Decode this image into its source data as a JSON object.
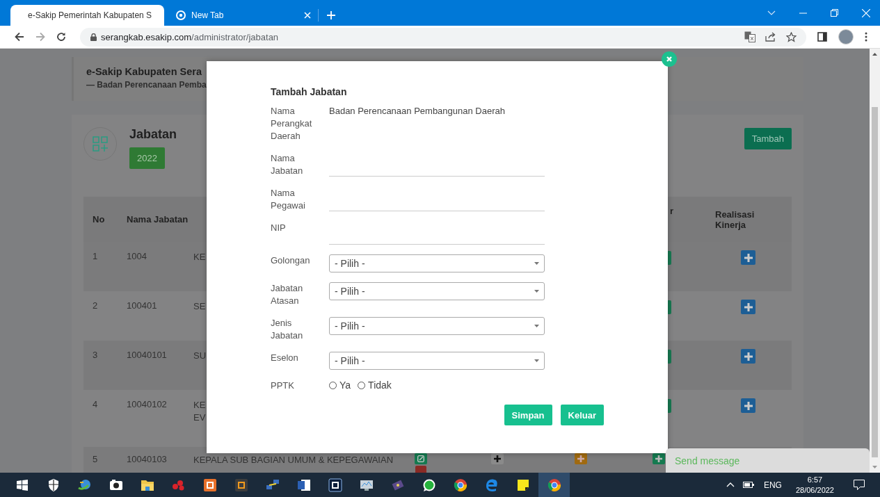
{
  "browser": {
    "tabs": [
      {
        "kind": "site",
        "title": "e-Sakip Pemerintah Kabupaten S",
        "selected": true
      },
      {
        "kind": "newtab",
        "title": "New Tab",
        "selected": false
      }
    ],
    "url_host": "serangkab.esakip.com",
    "url_path": "/administrator/jabatan"
  },
  "page": {
    "site_title": "e-Sakip Kabupaten Sera",
    "site_subtitle": "— Badan Perencanaan Pemba",
    "section_title": "Jabatan",
    "year_badge": "2022",
    "add_button": "Tambah",
    "table": {
      "column_headers": [
        "No",
        "Nama Jabatan",
        "r",
        "Realisasi Kinerja"
      ],
      "rows": [
        {
          "kind": "covered",
          "no": "1",
          "code": "1004",
          "name": "KE"
        },
        {
          "kind": "covered",
          "no": "2",
          "code": "100401",
          "name": "SE"
        },
        {
          "kind": "covered",
          "no": "3",
          "code": "10040101",
          "name": "SU"
        },
        {
          "kind": "covered",
          "no": "4",
          "code": "10040102",
          "name": "KE\nEV"
        },
        {
          "kind": "open",
          "no": "5",
          "code": "10040103",
          "name": "KEPALA SUB BAGIAN UMUM & KEPEGAWAIAN"
        }
      ]
    }
  },
  "modal": {
    "title": "Tambah Jabatan",
    "fields": [
      {
        "kind": "text",
        "label": "Nama Perangkat Daerah",
        "value": "Badan Perencanaan Pembangunan Daerah"
      },
      {
        "kind": "input",
        "label": "Nama Jabatan"
      },
      {
        "kind": "input",
        "label": "Nama Pegawai"
      },
      {
        "kind": "input",
        "label": "NIP"
      },
      {
        "kind": "select",
        "label": "Golongan",
        "value": "- Pilih -"
      },
      {
        "kind": "select",
        "label": "Jabatan Atasan",
        "value": "- Pilih -"
      },
      {
        "kind": "select",
        "label": "Jenis Jabatan",
        "value": "- Pilih -"
      },
      {
        "kind": "select",
        "label": "Eselon",
        "value": "- Pilih -"
      },
      {
        "kind": "radio",
        "label": "PPTK",
        "options": [
          {
            "label": "Ya",
            "selected": false
          },
          {
            "label": "Tidak",
            "selected": false
          }
        ]
      }
    ],
    "buttons": [
      "Simpan",
      "Keluar"
    ]
  },
  "chat": {
    "label": "Send message"
  },
  "taskbar": {
    "items": [
      {
        "kind": "start",
        "selected": false
      },
      {
        "kind": "shield",
        "selected": false
      },
      {
        "kind": "globe",
        "selected": false
      },
      {
        "kind": "camera",
        "selected": false
      },
      {
        "kind": "folder",
        "selected": false
      },
      {
        "kind": "dots",
        "selected": false
      },
      {
        "kind": "tile-orange",
        "selected": false
      },
      {
        "kind": "tile-dark",
        "selected": false
      },
      {
        "kind": "computers",
        "selected": false
      },
      {
        "kind": "doc",
        "selected": false
      },
      {
        "kind": "tile-navy",
        "selected": false
      },
      {
        "kind": "monitor",
        "selected": false
      },
      {
        "kind": "film",
        "selected": false
      },
      {
        "kind": "chat",
        "selected": false
      },
      {
        "kind": "ring",
        "selected": false
      },
      {
        "kind": "e",
        "selected": false
      },
      {
        "kind": "note",
        "selected": false
      },
      {
        "kind": "ring",
        "selected": true
      }
    ],
    "language": "ENG",
    "time": "6:57",
    "date": "28/06/2022"
  }
}
